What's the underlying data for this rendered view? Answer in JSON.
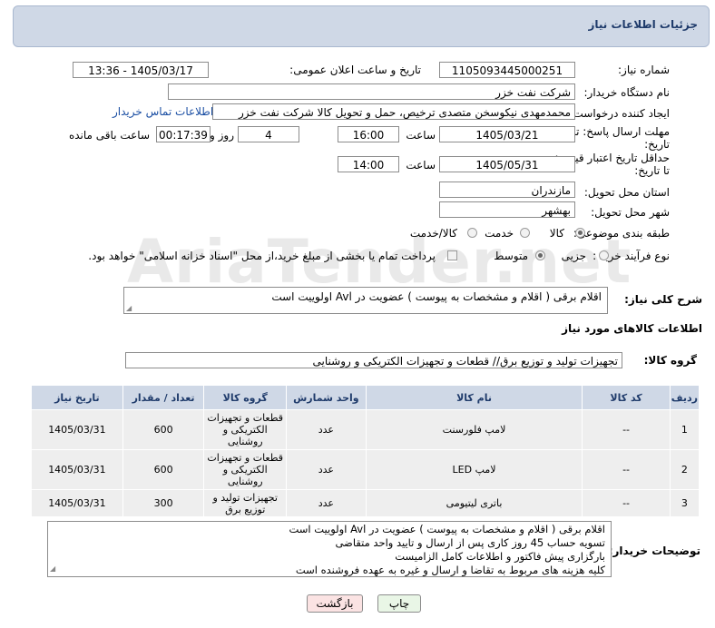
{
  "header": {
    "title": "جزئیات اطلاعات نیاز"
  },
  "watermark": "AriaTender.net",
  "form": {
    "need_number_label": "شماره نیاز:",
    "need_number": "1105093445000251",
    "announce_label": "تاریخ و ساعت اعلان عمومی:",
    "announce_value": "1405/03/17 - 13:36",
    "buyer_org_label": "نام دستگاه خریدار:",
    "buyer_org": "شرکت نفت خزر",
    "creator_label": "ایجاد کننده درخواست:",
    "creator": "محمدمهدی نیکوسخن متصدی ترخیص، حمل و تحویل کالا شرکت نفت خزر",
    "contact_link": "اطلاعات تماس خریدار",
    "deadline_label_1": "مهلت ارسال پاسخ: تا",
    "deadline_label_2": "تاریخ:",
    "deadline_date": "1405/03/21",
    "time_label": "ساعت",
    "deadline_time": "16:00",
    "days_value": "4",
    "days_label": "روز و",
    "remaining_value": "00:17:39",
    "remaining_label": "ساعت باقی مانده",
    "validity_label_1": "حداقل تاریخ اعتبار قیمت:",
    "validity_label_2": "تا تاریخ:",
    "validity_date": "1405/05/31",
    "validity_time": "14:00",
    "province_label": "استان محل تحویل:",
    "province": "مازندران",
    "city_label": "شهر محل تحویل:",
    "city": "بهشهر",
    "category_label": "طبقه بندی موضوعی:",
    "category_options": [
      "کالا",
      "خدمت",
      "کالا/خدمت"
    ],
    "process_label": "نوع فرآیند خرید :",
    "process_options": [
      "جزیی",
      "متوسط"
    ],
    "payment_note": "پرداخت تمام یا بخشی از مبلغ خرید،از محل \"اسناد خزانه اسلامی\" خواهد بود.",
    "desc_label": "شرح کلی نیاز:",
    "desc": "اقلام برقی ( اقلام و مشخصات به پیوست ) عضویت در Avl اولوییت است"
  },
  "goods": {
    "section_title": "اطلاعات کالاهای مورد نیاز",
    "group_label": "گروه کالا:",
    "group_value": "تجهیزات تولید و توزیع برق// قطعات و تجهیزات الکتریکی و روشنایی",
    "columns": [
      "ردیف",
      "کد کالا",
      "نام کالا",
      "واحد شمارش",
      "گروه کالا",
      "تعداد / مقدار",
      "تاریخ نیاز"
    ],
    "rows": [
      {
        "row": "1",
        "code": "--",
        "name": "لامپ فلورسنت",
        "unit": "عدد",
        "group": "قطعات و تجهیزات الکتریکی و روشنایی",
        "qty": "600",
        "date": "1405/03/31"
      },
      {
        "row": "2",
        "code": "--",
        "name": "لامپ LED",
        "unit": "عدد",
        "group": "قطعات و تجهیزات الکتریکی و روشنایی",
        "qty": "600",
        "date": "1405/03/31"
      },
      {
        "row": "3",
        "code": "--",
        "name": "باتری لیتیومی",
        "unit": "عدد",
        "group": "تجهیزات تولید و توزیع برق",
        "qty": "300",
        "date": "1405/03/31"
      }
    ]
  },
  "buyer_notes": {
    "label": "توضیحات خریدار:",
    "lines": [
      "اقلام برقی ( اقلام و مشخصات به پیوست ) عضویت در Avl اولوییت است",
      "تسویه حساب 45 روز کاری پس از ارسال و تایید واحد متقاضی",
      "بارگزاری پیش فاکتور و اطلاعات کامل الزامیست",
      "کلیه هزینه های مربوط به تقاضا و ارسال و غیره به عهده فروشنده است"
    ]
  },
  "buttons": {
    "print": "چاپ",
    "back": "بازگشت"
  }
}
